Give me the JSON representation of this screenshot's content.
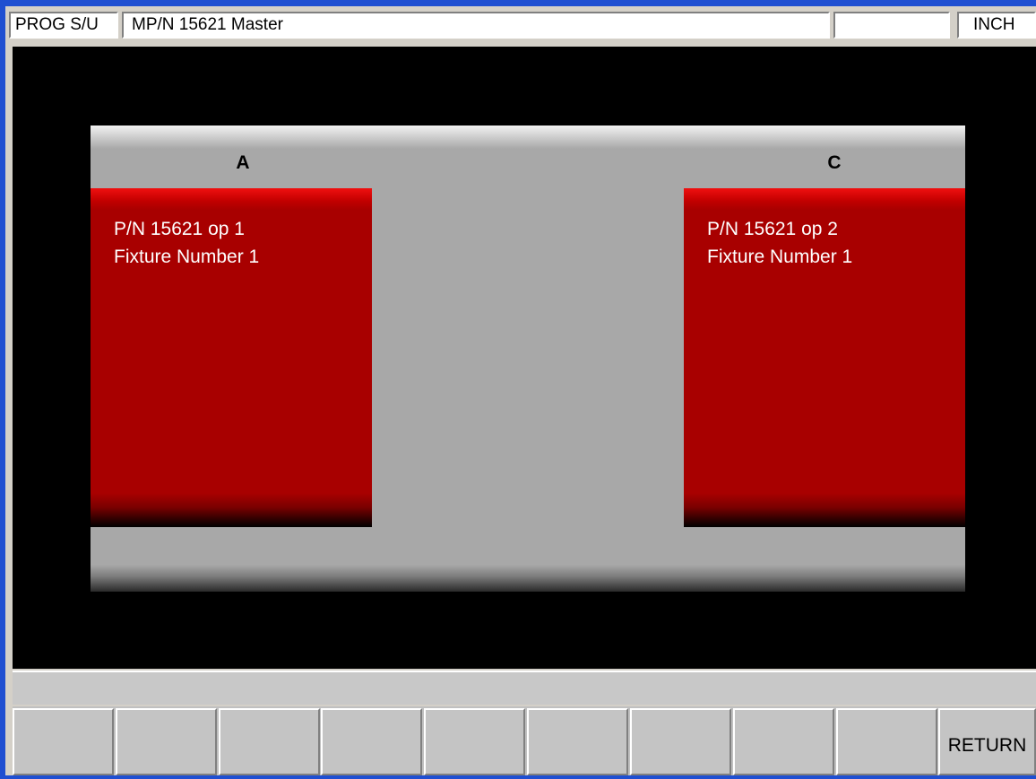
{
  "header": {
    "mode": "PROG S/U",
    "program_name": "MP/N 15621 Master",
    "blank": "",
    "units": "INCH"
  },
  "table": {
    "pallets": [
      {
        "label": "A",
        "lines": [
          "P/N 15621 op 1",
          "Fixture Number 1"
        ],
        "color": "#a80000"
      },
      {
        "label": "C",
        "lines": [
          "P/N 15621 op 2",
          "Fixture Number 1"
        ],
        "color": "#a80000"
      }
    ]
  },
  "message_bar": {
    "text": ""
  },
  "softkeys": [
    "",
    "",
    "",
    "",
    "",
    "",
    "",
    "",
    "",
    "RETURN"
  ]
}
